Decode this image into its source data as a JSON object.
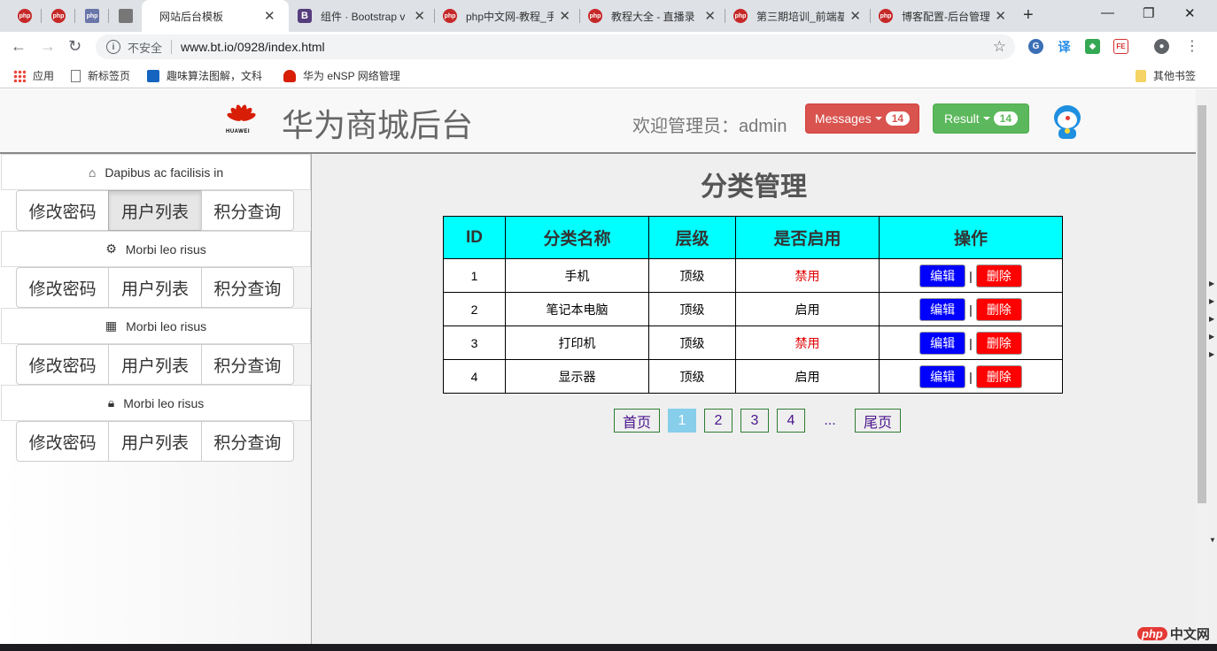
{
  "browser": {
    "tabs": [
      {
        "title": "",
        "icon": "php-icon"
      },
      {
        "title": "",
        "icon": "php-icon"
      },
      {
        "title": "",
        "icon": "php-site-icon"
      },
      {
        "title": "",
        "icon": "github-icon"
      },
      {
        "title": "网站后台模板",
        "icon": "page-icon",
        "active": true
      },
      {
        "title": "组件 · Bootstrap v",
        "icon": "bootstrap-icon"
      },
      {
        "title": "php中文网-教程_手",
        "icon": "php-icon"
      },
      {
        "title": "教程大全 - 直播录",
        "icon": "php-icon"
      },
      {
        "title": "第三期培训_前端基",
        "icon": "php-icon"
      },
      {
        "title": "博客配置-后台管理",
        "icon": "php-icon"
      }
    ],
    "insecure_label": "不安全",
    "url": "www.bt.io/0928/index.html",
    "bookmarks": [
      {
        "label": "应用",
        "icon": "apps-grid-icon"
      },
      {
        "label": "新标签页",
        "icon": "page-icon"
      },
      {
        "label": "趣味算法图解，文科",
        "icon": "c-logo-icon"
      },
      {
        "label": "华为 eNSP 网络管理",
        "icon": "huawei-icon"
      }
    ],
    "other_bookmarks": "其他书签"
  },
  "header": {
    "logo_word": "HUAWEI",
    "site_title": "华为商城后台",
    "welcome": "欢迎管理员：admin",
    "messages_label": "Messages",
    "messages_count": "14",
    "result_label": "Result",
    "result_count": "14",
    "colors": {
      "danger": "#d9534f",
      "success": "#5cb85c"
    }
  },
  "sidebar": {
    "groups": [
      {
        "title": "Dapibus ac facilisis in",
        "icon": "home-icon",
        "buttons": [
          "修改密码",
          "用户列表",
          "积分查询"
        ]
      },
      {
        "title": "Morbi leo risus",
        "icon": "gear-icon",
        "buttons": [
          "修改密码",
          "用户列表",
          "积分查询"
        ]
      },
      {
        "title": "Morbi leo risus",
        "icon": "grid-icon",
        "buttons": [
          "修改密码",
          "用户列表",
          "积分查询"
        ]
      },
      {
        "title": "Morbi leo risus",
        "icon": "lock-icon",
        "buttons": [
          "修改密码",
          "用户列表",
          "积分查询"
        ]
      }
    ]
  },
  "main": {
    "title": "分类管理",
    "table": {
      "headers": [
        "ID",
        "分类名称",
        "层级",
        "是否启用",
        "操作"
      ],
      "rows": [
        {
          "id": "1",
          "name": "手机",
          "level": "顶级",
          "status": "禁用"
        },
        {
          "id": "2",
          "name": "笔记本电脑",
          "level": "顶级",
          "status": "启用"
        },
        {
          "id": "3",
          "name": "打印机",
          "level": "顶级",
          "status": "禁用"
        },
        {
          "id": "4",
          "name": "显示器",
          "level": "顶级",
          "status": "启用"
        }
      ],
      "edit_label": "编辑",
      "delete_label": "删除",
      "separator": "|",
      "header_color": "#00ffff"
    },
    "pagination": {
      "first": "首页",
      "pages": [
        "1",
        "2",
        "3",
        "4"
      ],
      "current": "1",
      "ellipsis": "...",
      "last": "尾页"
    }
  },
  "watermark": {
    "logo": "php",
    "text": "中文网"
  }
}
